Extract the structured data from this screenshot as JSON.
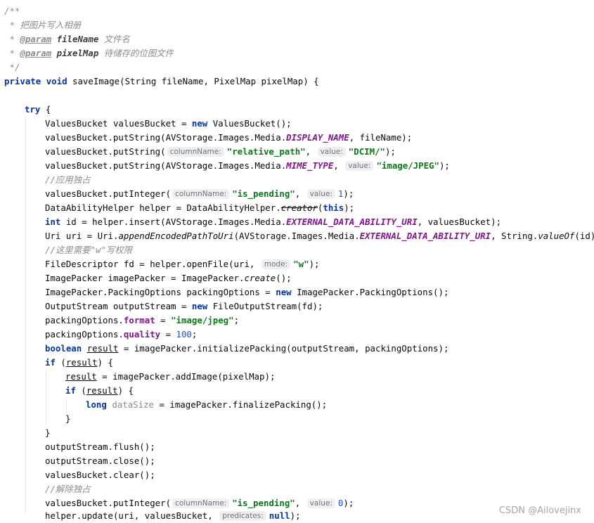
{
  "editor": {
    "doc_open": "/**",
    "doc_desc": " * 把图片写入相册",
    "doc_star": " * ",
    "param_tag": "@param",
    "param1_name": "fileName",
    "param1_desc": "文件名",
    "param2_name": "pixelMap",
    "param2_desc": "待储存的位图文件",
    "doc_close": " */",
    "method_sig": {
      "private": "private",
      "void": "void",
      "rest": " saveImage(String fileName, PixelMap pixelMap) {"
    },
    "try_kw": "try",
    "try_brace": " {",
    "l_vb_decl": {
      "pre": "ValuesBucket valuesBucket = ",
      "new": "new",
      "post": " ValuesBucket();"
    },
    "l_put1": {
      "pre": "valuesBucket.putString(AVStorage.Images.Media.",
      "const": "DISPLAY_NAME",
      "post": ", fileName);"
    },
    "l_put2": {
      "pre": "valuesBucket.putString(",
      "hint1": "columnName:",
      "str1": "\"relative_path\"",
      "mid": ", ",
      "hint2": "value:",
      "str2": "\"DCIM/\"",
      "post": ");"
    },
    "l_put3": {
      "pre": "valuesBucket.putString(AVStorage.Images.Media.",
      "const": "MIME_TYPE",
      "mid": ", ",
      "hint": "value:",
      "str": "\"image/JPEG\"",
      "post": ");"
    },
    "comment_exclusive": "//应用独占",
    "l_putint1": {
      "pre": "valuesBucket.putInteger(",
      "hint1": "columnName:",
      "str": "\"is_pending\"",
      "mid": ", ",
      "hint2": "value:",
      "num": "1",
      "post": ");"
    },
    "l_helper": {
      "pre": "DataAbilityHelper helper = DataAbilityHelper.",
      "deprecated": "creator",
      "open": "(",
      "this": "this",
      "post": ");"
    },
    "l_insert": {
      "int": "int",
      "pre": " id = helper.insert(AVStorage.Images.Media.",
      "const": "EXTERNAL_DATA_ABILITY_URI",
      "post": ", valuesBucket);"
    },
    "l_uri": {
      "pre": "Uri uri = Uri.",
      "static": "appendEncodedPathToUri",
      "mid": "(AVStorage.Images.Media.",
      "const": "EXTERNAL_DATA_ABILITY_URI",
      "mid2": ", String.",
      "static2": "valueOf",
      "post": "(id));"
    },
    "comment_write": "//这里需要\"w\"写权限",
    "l_fd": {
      "pre": "FileDescriptor fd = helper.openFile(uri, ",
      "hint": "mode:",
      "str": "\"w\"",
      "post": ");"
    },
    "l_packer": {
      "pre": "ImagePacker imagePacker = ImagePacker.",
      "static": "create",
      "post": "();"
    },
    "l_opts": {
      "pre": "ImagePacker.PackingOptions packingOptions = ",
      "new": "new",
      "post": " ImagePacker.PackingOptions();"
    },
    "l_stream": {
      "pre": "OutputStream outputStream = ",
      "new": "new",
      "post": " FileOutputStream(fd);"
    },
    "l_format": {
      "pre": "packingOptions.",
      "field": "format",
      "mid": " = ",
      "str": "\"image/jpeg\"",
      "post": ";"
    },
    "l_quality": {
      "pre": "packingOptions.",
      "field": "quality",
      "mid": " = ",
      "num": "100",
      "post": ";"
    },
    "l_bool": {
      "kw": "boolean",
      "sp": " ",
      "var": "result",
      "post": " = imagePacker.initializePacking(outputStream, packingOptions);"
    },
    "l_if1": {
      "kw": "if",
      "open": " (",
      "var": "result",
      "post": ") {"
    },
    "l_add": {
      "var": "result",
      "post": " = imagePacker.addImage(pixelMap);"
    },
    "l_if2": {
      "kw": "if",
      "open": " (",
      "var": "result",
      "post": ") {"
    },
    "l_long": {
      "kw": "long",
      "sp": " ",
      "var": "dataSize",
      "post": " = imagePacker.finalizePacking();"
    },
    "close_brace": "}",
    "l_flush": "outputStream.flush();",
    "l_close": "outputStream.close();",
    "l_clear": "valuesBucket.clear();",
    "comment_release": "//解除独占",
    "l_putint2": {
      "pre": "valuesBucket.putInteger(",
      "hint1": "columnName:",
      "str": "\"is_pending\"",
      "mid": ", ",
      "hint2": "value:",
      "num": "0",
      "post": ");"
    },
    "l_update": {
      "pre": "helper.update(uri, valuesBucket, ",
      "hint": "predicates:",
      "kw": "null",
      "post": ");"
    }
  },
  "watermark": "CSDN @Ailovejinx",
  "colors": {
    "keyword": "#0033b3",
    "string": "#067d17",
    "number": "#1750eb",
    "comment": "#8c8c8c",
    "constant": "#871094"
  }
}
